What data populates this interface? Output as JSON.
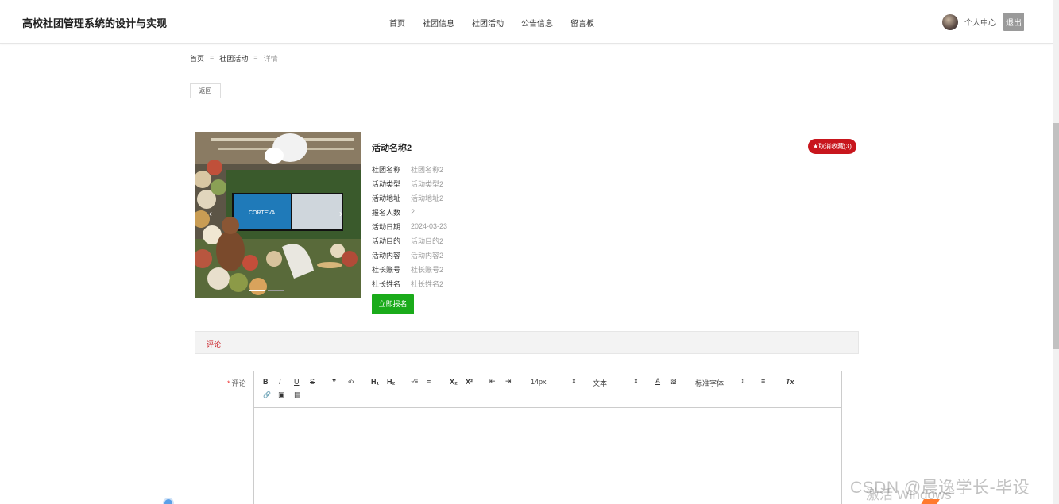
{
  "header": {
    "site_title": "高校社团管理系统的设计与实现",
    "nav": [
      "首页",
      "社团信息",
      "社团活动",
      "公告信息",
      "留言板"
    ],
    "user_center": "个人中心",
    "logout": "退出"
  },
  "breadcrumb": {
    "home": "首页",
    "sep1": "=",
    "section": "社团活动",
    "sep2": "=",
    "current": "详情"
  },
  "back_button": "返回",
  "detail": {
    "title": "活动名称2",
    "favorite_badge": "★取消收藏(3)",
    "fields": [
      {
        "label": "社团名称",
        "value": "社团名称2"
      },
      {
        "label": "活动类型",
        "value": "活动类型2"
      },
      {
        "label": "活动地址",
        "value": "活动地址2"
      },
      {
        "label": "报名人数",
        "value": "2"
      },
      {
        "label": "活动日期",
        "value": "2024-03-23"
      },
      {
        "label": "活动目的",
        "value": "活动目的2"
      },
      {
        "label": "活动内容",
        "value": "活动内容2"
      },
      {
        "label": "社长账号",
        "value": "社长账号2"
      },
      {
        "label": "社长姓名",
        "value": "社长姓名2"
      }
    ],
    "signup_button": "立即报名",
    "image_brand_text": "CORTEVA"
  },
  "comment": {
    "section_title": "评论",
    "required_mark": "*",
    "field_label": "评论",
    "toolbar": {
      "bold": "B",
      "italic": "I",
      "underline": "U",
      "strike": "S",
      "quote": "❞",
      "code": "‹/›",
      "h1": "H₁",
      "h2": "H₂",
      "ordered_list": "⅟≡",
      "bullet_list": "≡",
      "subscript": "X₂",
      "superscript": "X²",
      "outdent": "⇤",
      "indent": "⇥",
      "font_size": "14px",
      "font_size_arrow": "⇕",
      "block_format": "文本",
      "block_format_arrow": "⇕",
      "font_color": "A",
      "background_color": "▨",
      "font_family": "标准字体",
      "font_family_arrow": "⇕",
      "align": "≡",
      "clear_format": "Tx",
      "link": "🔗",
      "image": "▣",
      "video": "▤"
    }
  },
  "overlay": {
    "watermark": "CSDN @晨逸学长-毕设",
    "activate_windows": "激活 Windows"
  }
}
